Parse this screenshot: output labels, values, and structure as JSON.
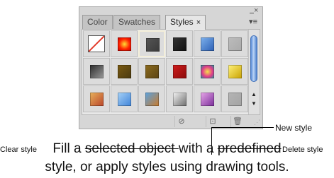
{
  "panel": {
    "tabs": [
      {
        "label": "Color"
      },
      {
        "label": "Swatches"
      },
      {
        "label": "Styles",
        "close_glyph": "×"
      }
    ],
    "active_tab": "Styles",
    "window_close_glyph": "×",
    "menu_glyph": "▾≡"
  },
  "styles": [
    {
      "name": "none-style",
      "colors": [
        "#ffffff"
      ]
    },
    {
      "name": "red-glow-style",
      "colors": [
        "#ffdd33",
        "#ff2200",
        "#c00000"
      ]
    },
    {
      "name": "dark-gray-selected-style",
      "colors": [
        "#555555",
        "#3a3a3a"
      ]
    },
    {
      "name": "black-bevel-style",
      "colors": [
        "#333333",
        "#111111"
      ]
    },
    {
      "name": "blue-metal-style",
      "colors": [
        "#7fb2ec",
        "#2b5fb5"
      ]
    },
    {
      "name": "gray-flat-style",
      "colors": [
        "#bcbcbc",
        "#aaaaaa"
      ]
    },
    {
      "name": "steel-gradient-style",
      "colors": [
        "#2c2c2c",
        "#9a9a9a"
      ]
    },
    {
      "name": "gold-texture-style",
      "colors": [
        "#7a5a12",
        "#4a3a10"
      ]
    },
    {
      "name": "bronze-texture-style",
      "colors": [
        "#8c6b1f",
        "#5b4413"
      ]
    },
    {
      "name": "red-stripes-style",
      "colors": [
        "#d01c1c",
        "#8a0a0a"
      ]
    },
    {
      "name": "multicolor-style",
      "colors": [
        "#f4e04a",
        "#e03a8a",
        "#1a9a9a"
      ]
    },
    {
      "name": "gold-frame-style",
      "colors": [
        "#fff27a",
        "#c9a200"
      ]
    },
    {
      "name": "orange-sunset-style",
      "colors": [
        "#e9b25c",
        "#b8452a"
      ]
    },
    {
      "name": "light-blue-style",
      "colors": [
        "#a6d1f7",
        "#3f84d8"
      ]
    },
    {
      "name": "sky-landscape-style",
      "colors": [
        "#5ba3e0",
        "#c87a2c"
      ]
    },
    {
      "name": "silver-chrome-style",
      "colors": [
        "#f4f4f4",
        "#6c6c6c"
      ]
    },
    {
      "name": "purple-gloss-style",
      "colors": [
        "#e7a6e8",
        "#7a2d9a"
      ]
    },
    {
      "name": "gray-plain-style",
      "colors": [
        "#b4b4b4",
        "#a4a4a4"
      ]
    }
  ],
  "footer": {
    "clear_glyph": "⊘",
    "new_glyph": "⊡",
    "delete_glyph": "🗑",
    "grip_glyph": "⋰"
  },
  "annotations": {
    "new_style": "New style",
    "clear_style": "Clear style",
    "delete_style": "Delete style"
  },
  "caption": {
    "line1_a": "Fill a ",
    "line1_b": "selected object ",
    "line1_c": "with a ",
    "line1_d": "predefined",
    "line2": "style, or apply styles using drawing tools."
  }
}
